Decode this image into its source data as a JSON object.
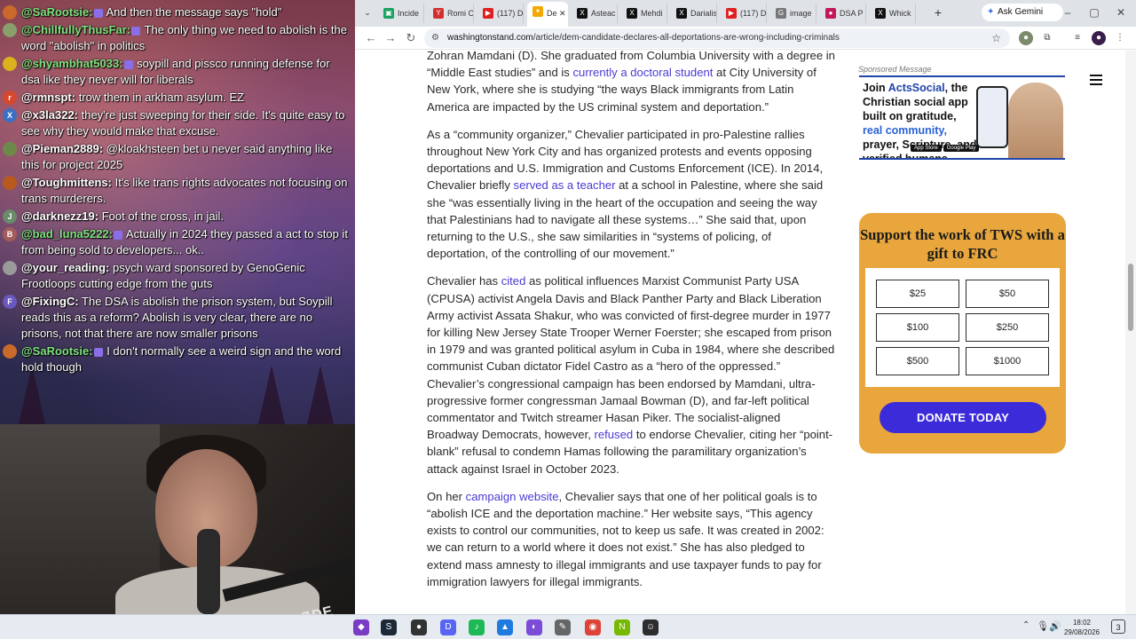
{
  "chat": {
    "messages": [
      {
        "user": "@SaRootsie:",
        "text": "And then the message says \"hold\"",
        "color": "#7ee37e"
      },
      {
        "user": "@ChillfullyThusFar:",
        "text": "The only thing we need to abolish is the word \"abolish\" in politics",
        "color": "#7ee37e"
      },
      {
        "user": "@shyambhat5033:",
        "text": "soypill and pissco running defense for dsa like they never will for liberals",
        "color": "#7ee37e"
      },
      {
        "user": "@rmnspt:",
        "text": "trow them in arkham asylum. EZ",
        "color": "#ffffff"
      },
      {
        "user": "@x3la322:",
        "text": "they're just sweeping for their side. It's quite easy to see why they would make that excuse.",
        "color": "#ffffff"
      },
      {
        "user": "@Pieman2889:",
        "text": "@kloakhsteen bet u never said anything like this for project 2025",
        "color": "#ffffff"
      },
      {
        "user": "@Toughmittens:",
        "text": "It's like trans rights advocates not focusing on trans murderers.",
        "color": "#ffffff"
      },
      {
        "user": "@darknezz19:",
        "text": "Foot of the cross, in jail.",
        "color": "#ffffff"
      },
      {
        "user": "@bad_luna5222:",
        "text": "Actually in 2024 they passed a act to stop it from being sold to developers... ok..",
        "color": "#7ee37e"
      },
      {
        "user": "@your_reading:",
        "text": "psych ward sponsored by GenoGenic Frootloops cutting edge from the guts",
        "color": "#ffffff"
      },
      {
        "user": "@FixingC:",
        "text": "The DSA is abolish the prison system, but Soypill reads this as a reform? Abolish is very clear, there are no prisons, not that there are now smaller prisons",
        "color": "#ffffff"
      },
      {
        "user": "@SaRootsie:",
        "text": "I don't normally see a weird sign and the word hold though",
        "color": "#7ee37e"
      }
    ],
    "avatar_initials": [
      "",
      "",
      "",
      "r",
      "X",
      "",
      "",
      "J",
      "B",
      "",
      "F",
      ""
    ],
    "avatar_colors": [
      "#c96a2b",
      "#8aa06a",
      "#d9b21e",
      "#d6482f",
      "#3b6fc4",
      "#6e8a4a",
      "#b85a1d",
      "#6a8a6a",
      "#a25c5c",
      "#9a9a9a",
      "#6a57c0",
      "#c96a2b"
    ],
    "webcam_label": "RØDE"
  },
  "browser": {
    "tabs": [
      {
        "label": "Incide",
        "fav_color": "#1aa260",
        "fav": "▣"
      },
      {
        "label": "Romi C",
        "fav_color": "#d32f2f",
        "fav": "Y"
      },
      {
        "label": "(117) D",
        "fav_color": "#e02020",
        "fav": "▶"
      },
      {
        "label": "De",
        "fav_color": "#f2a900",
        "fav": "✦",
        "active": true
      },
      {
        "label": "Asteac",
        "fav_color": "#111111",
        "fav": "X"
      },
      {
        "label": "Mehdi",
        "fav_color": "#111111",
        "fav": "X"
      },
      {
        "label": "Darialis",
        "fav_color": "#111111",
        "fav": "X"
      },
      {
        "label": "(117) D",
        "fav_color": "#e02020",
        "fav": "▶"
      },
      {
        "label": "image",
        "fav_color": "#777777",
        "fav": "G"
      },
      {
        "label": "DSA P",
        "fav_color": "#c2185b",
        "fav": "●"
      },
      {
        "label": "Whick",
        "fav_color": "#111111",
        "fav": "X"
      }
    ],
    "gemini_label": "Ask Gemini",
    "url_domain": "washingtonstand.com",
    "url_path": "/article/dem-candidate-declares-all-deportations-are-wrong-including-criminals"
  },
  "article": {
    "p1": [
      {
        "t": "Zohran Mamdani (D). She graduated from Columbia University with a degree in “Middle East studies” and is "
      },
      {
        "t": "currently a doctoral student",
        "link": true
      },
      {
        "t": " at City University of New York, where she is studying “the ways Black immigrants from Latin America are impacted by the US criminal system and deportation.”"
      }
    ],
    "p2": [
      {
        "t": "As a “community organizer,” Chevalier participated in pro-Palestine rallies throughout New York City and has organized protests and events opposing deportations and U.S. Immigration and Customs Enforcement (ICE). In 2014, Chevalier briefly "
      },
      {
        "t": "served as a teacher",
        "link": true
      },
      {
        "t": " at a school in Palestine, where she said she “was essentially living in the heart of the occupation and seeing the way that Palestinians had to navigate all these systems…” She said that, upon returning to the U.S., she saw similarities in “systems of policing, of deportation, of the controlling of our movement.”"
      }
    ],
    "p3": [
      {
        "t": "Chevalier has "
      },
      {
        "t": "cited",
        "link": true
      },
      {
        "t": " as political influences Marxist Communist Party USA (CPUSA) activist Angela Davis and Black Panther Party and Black Liberation Army activist Assata Shakur, who was convicted of first-degree murder in 1977 for killing New Jersey State Trooper Werner Foerster; she escaped from prison in 1979 and was granted political asylum in Cuba in 1984, where she described communist Cuban dictator Fidel Castro as a “hero of the oppressed.” Chevalier’s congressional campaign has been endorsed by Mamdani, ultra-progressive former congressman Jamaal Bowman (D), and far-left political commentator and Twitch streamer Hasan Piker. The socialist-aligned Broadway Democrats, however, "
      },
      {
        "t": "refused",
        "link": true
      },
      {
        "t": " to endorse Chevalier, citing her “point-blank” refusal to condemn Hamas following the paramilitary organization’s attack against Israel in October 2023."
      }
    ],
    "p4": [
      {
        "t": "On her "
      },
      {
        "t": "campaign website",
        "link": true
      },
      {
        "t": ", Chevalier says that one of her political goals is to “abolish ICE and the deportation machine.” Her website says, “This agency exists to control our communities, not to keep us safe. It was created in 2002: we can return to a world where it does not exist.” She has also pledged to extend mass amnesty to illegal immigrants and use taxpayer funds to pay for immigration lawyers for illegal immigrants."
      }
    ]
  },
  "sidebar": {
    "ad_label": "Sponsored Message",
    "ad_join": "Join ",
    "ad_brand": "ActsSocial",
    "ad_line1": ", the Christian social app built on gratitude, ",
    "ad_real": "real community,",
    "ad_line2": " prayer, Scripture, and verified humans.",
    "ad_store1": "App Store",
    "ad_store2": "Google Play",
    "donate_title": "Support the work of TWS with a gift to FRC",
    "amounts": [
      "$25",
      "$50",
      "$100",
      "$250",
      "$500",
      "$1000"
    ],
    "donate_button": "DONATE TODAY"
  },
  "taskbar": {
    "apps": [
      {
        "name": "radeon",
        "color": "#7a3cc4",
        "glyph": "◆"
      },
      {
        "name": "steam",
        "color": "#1b2838",
        "glyph": "S"
      },
      {
        "name": "obs",
        "color": "#333333",
        "glyph": "●"
      },
      {
        "name": "discord",
        "color": "#5865f2",
        "glyph": "D"
      },
      {
        "name": "spotify",
        "color": "#1db954",
        "glyph": "♪"
      },
      {
        "name": "app-blue",
        "color": "#1e7be0",
        "glyph": "▲"
      },
      {
        "name": "app-purple",
        "color": "#7b4cd6",
        "glyph": "◐"
      },
      {
        "name": "app-gray",
        "color": "#666666",
        "glyph": "✎"
      },
      {
        "name": "chrome",
        "color": "#db4437",
        "glyph": "◉"
      },
      {
        "name": "nvidia",
        "color": "#76b900",
        "glyph": "N"
      },
      {
        "name": "app-dark",
        "color": "#2d2d2d",
        "glyph": "☺"
      }
    ],
    "time": "18:02",
    "date": "29/08/2026",
    "notifications": "3"
  }
}
